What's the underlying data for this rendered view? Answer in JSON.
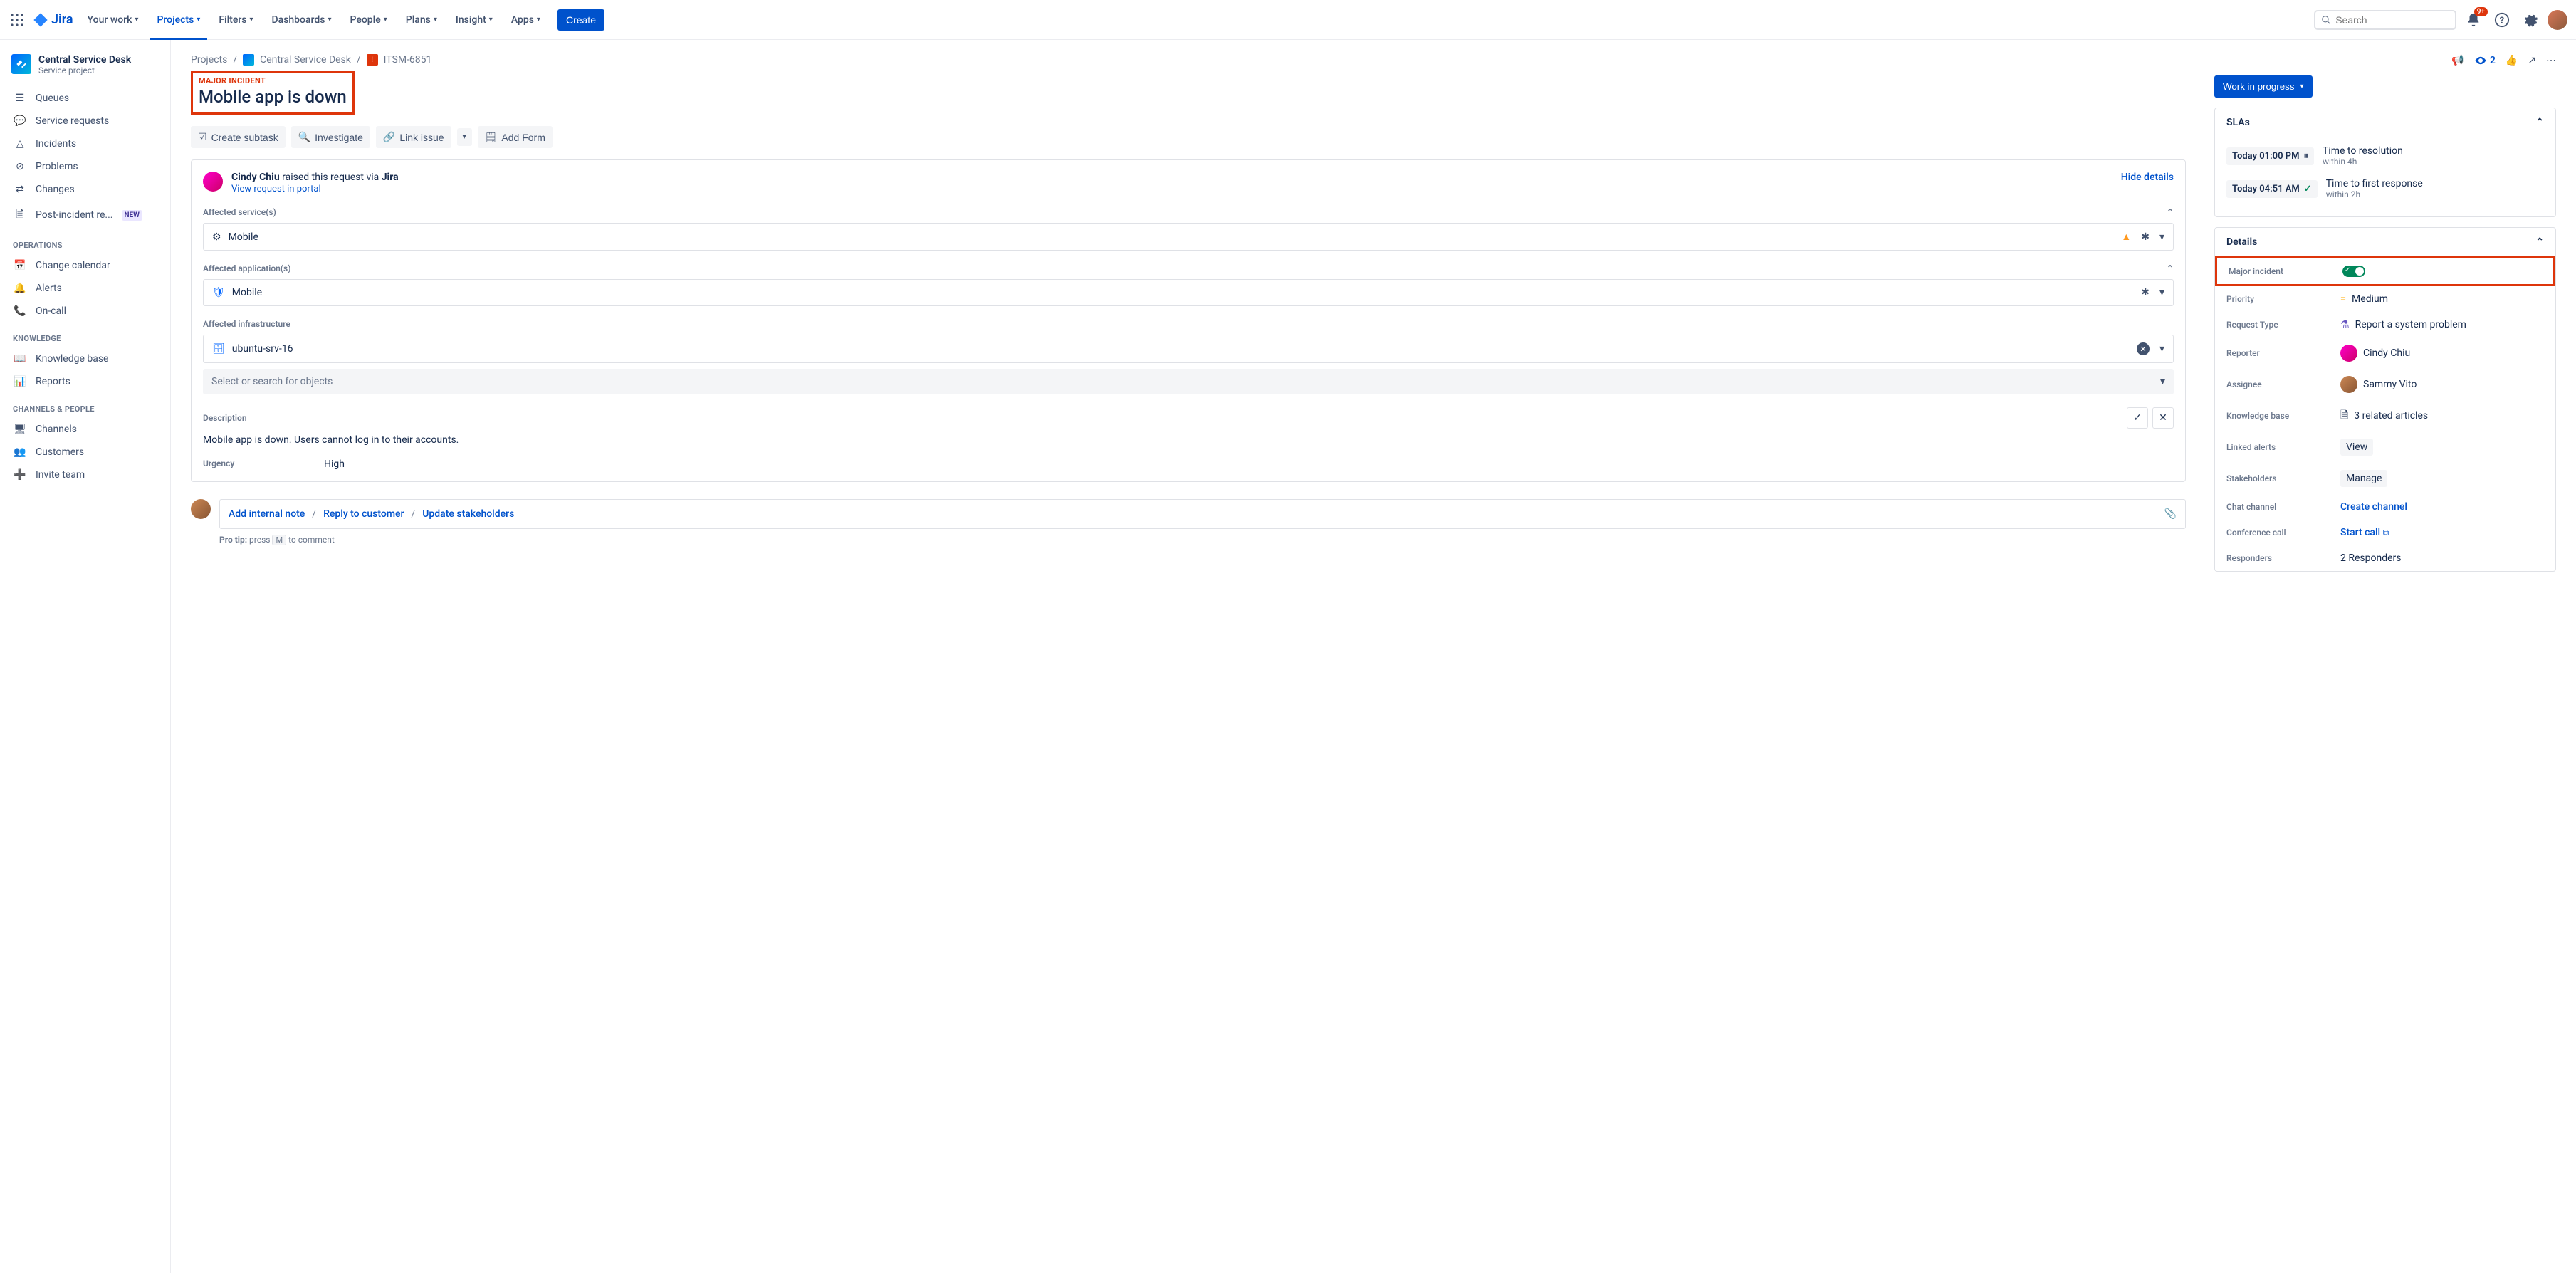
{
  "topnav": {
    "product": "Jira",
    "items": [
      "Your work",
      "Projects",
      "Filters",
      "Dashboards",
      "People",
      "Plans",
      "Insight",
      "Apps"
    ],
    "active": "Projects",
    "create": "Create",
    "search_placeholder": "Search",
    "notif_badge": "9+"
  },
  "sidebar": {
    "project_name": "Central Service Desk",
    "project_sub": "Service project",
    "items": [
      {
        "label": "Queues",
        "icon": "queue"
      },
      {
        "label": "Service requests",
        "icon": "chat"
      },
      {
        "label": "Incidents",
        "icon": "warn"
      },
      {
        "label": "Problems",
        "icon": "block"
      },
      {
        "label": "Changes",
        "icon": "swap"
      },
      {
        "label": "Post-incident re...",
        "icon": "doc",
        "badge": "NEW"
      }
    ],
    "section_ops": "OPERATIONS",
    "ops_items": [
      {
        "label": "Change calendar",
        "icon": "cal"
      },
      {
        "label": "Alerts",
        "icon": "bell"
      },
      {
        "label": "On-call",
        "icon": "phone"
      }
    ],
    "section_know": "KNOWLEDGE",
    "know_items": [
      {
        "label": "Knowledge base",
        "icon": "book"
      },
      {
        "label": "Reports",
        "icon": "chart"
      }
    ],
    "section_chan": "CHANNELS & PEOPLE",
    "chan_items": [
      {
        "label": "Channels",
        "icon": "screen"
      },
      {
        "label": "Customers",
        "icon": "people"
      },
      {
        "label": "Invite team",
        "icon": "invite"
      }
    ]
  },
  "breadcrumb": {
    "projects": "Projects",
    "project": "Central Service Desk",
    "key": "ITSM-6851"
  },
  "issue": {
    "major_tag": "MAJOR INCIDENT",
    "title": "Mobile app is down",
    "actions": {
      "subtask": "Create subtask",
      "investigate": "Investigate",
      "link": "Link issue",
      "form": "Add Form"
    },
    "requester_name": "Cindy Chiu",
    "requester_text": " raised this request via ",
    "requester_via": "Jira",
    "portal": "View request in portal",
    "hide": "Hide details",
    "affected_services_label": "Affected service(s)",
    "affected_service_value": "Mobile",
    "affected_apps_label": "Affected application(s)",
    "affected_app_value": "Mobile",
    "affected_infra_label": "Affected infrastructure",
    "affected_infra_value": "ubuntu-srv-16",
    "search_objects": "Select or search for objects",
    "desc_label": "Description",
    "desc_text": "Mobile app is down. Users cannot log in to their accounts.",
    "urgency_label": "Urgency",
    "urgency_value": "High",
    "comment": {
      "internal": "Add internal note",
      "reply": "Reply to customer",
      "stakeholders": "Update stakeholders"
    },
    "protip_pre": "Pro tip:",
    "protip_press": " press ",
    "protip_key": "M",
    "protip_post": " to comment"
  },
  "right": {
    "watch_count": "2",
    "status": "Work in progress",
    "slas_title": "SLAs",
    "sla1_time": "Today 01:00 PM",
    "sla1_title": "Time to resolution",
    "sla1_sub": "within 4h",
    "sla2_time": "Today 04:51 AM",
    "sla2_title": "Time to first response",
    "sla2_sub": "within 2h",
    "details_title": "Details",
    "rows": {
      "major": {
        "label": "Major incident"
      },
      "priority": {
        "label": "Priority",
        "value": "Medium"
      },
      "reqtype": {
        "label": "Request Type",
        "value": "Report a system problem"
      },
      "reporter": {
        "label": "Reporter",
        "value": "Cindy Chiu"
      },
      "assignee": {
        "label": "Assignee",
        "value": "Sammy Vito"
      },
      "kb": {
        "label": "Knowledge base",
        "value": "3 related articles"
      },
      "alerts": {
        "label": "Linked alerts",
        "value": "View"
      },
      "stakeholders": {
        "label": "Stakeholders",
        "value": "Manage"
      },
      "chat": {
        "label": "Chat channel",
        "value": "Create channel"
      },
      "conf": {
        "label": "Conference call",
        "value": "Start call"
      },
      "resp": {
        "label": "Responders",
        "value": "2 Responders"
      }
    }
  }
}
